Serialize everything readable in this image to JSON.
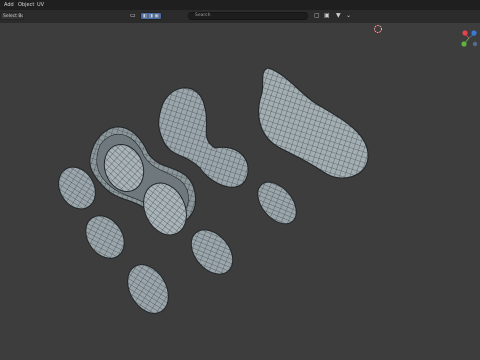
{
  "menu": {
    "add": "Add",
    "object": "Object",
    "uv": "UV"
  },
  "header": {
    "select_mode": "Select Box",
    "transform_orientation": "Global",
    "search_placeholder": "Search"
  },
  "colors": {
    "viewport_bg": "#3d3d3d",
    "mesh_fill": "#9aa6ab",
    "mesh_wire": "#2a2e31",
    "gizmo_x": "#e0444e",
    "gizmo_y": "#5fb33c",
    "gizmo_z": "#3b7bd6"
  },
  "icons": {
    "orientation": "globe-icon",
    "pivot": "pivot-icon",
    "snap": "magnet-icon",
    "proportional": "proportional-icon",
    "filter": "filter-icon",
    "gizmo": "navigation-gizmo-icon",
    "cursor": "3d-cursor-icon"
  }
}
